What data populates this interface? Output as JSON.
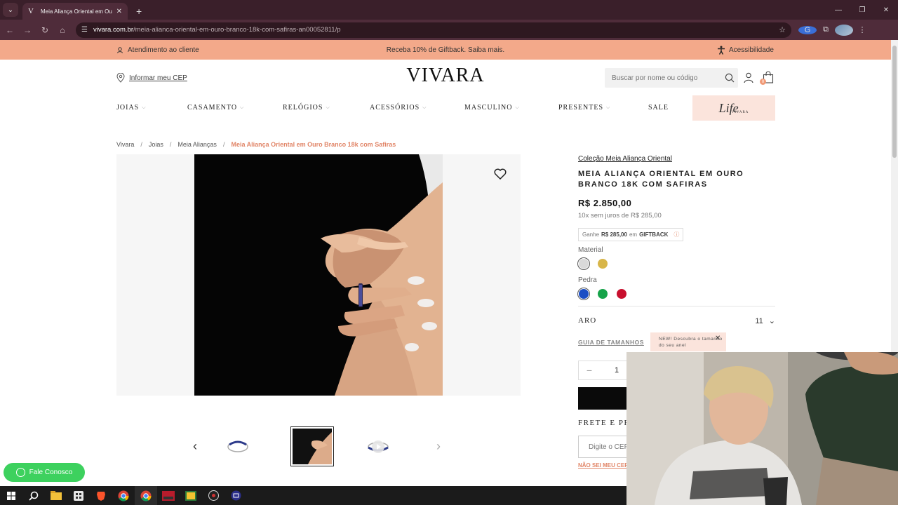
{
  "browser": {
    "tab_title": "Meia Aliança Oriental em Ouro Br",
    "tab_favicon": "V",
    "url_host": "vivara.com.br",
    "url_path": "/meia-alianca-oriental-em-ouro-branco-18k-com-safiras-an00052811/p",
    "extension_badge": "G"
  },
  "promo": {
    "support": "Atendimento ao cliente",
    "giftback": "Receba 10% de Giftback. Saiba mais.",
    "accessibility": "Acessibilidade"
  },
  "header": {
    "cep_link": "Informar meu CEP",
    "logo": "VIVARA",
    "search_placeholder": "Buscar por nome ou código",
    "bag_count": "0"
  },
  "nav": {
    "items": [
      "JOIAS",
      "CASAMENTO",
      "RELÓGIOS",
      "ACESSÓRIOS",
      "MASCULINO",
      "PRESENTES",
      "SALE"
    ],
    "life_logo": "Life",
    "life_sub": "VIVARA"
  },
  "breadcrumb": {
    "items": [
      "Vivara",
      "Joias",
      "Meia Alianças"
    ],
    "current": "Meia Aliança Oriental em Ouro Branco 18k com Safiras"
  },
  "product": {
    "collection": "Coleção Meia Aliança Oriental",
    "name": "MEIA ALIANÇA ORIENTAL EM OURO BRANCO 18K COM SAFIRAS",
    "price": "R$ 2.850,00",
    "installments": "10x sem juros de R$ 285,00",
    "giftback_prefix": "Ganhe",
    "giftback_amount": "R$ 285,00",
    "giftback_mid": "em",
    "giftback_label": "GIFTBACK",
    "material_label": "Material",
    "stone_label": "Pedra",
    "aro_label": "ARO",
    "aro_value": "11",
    "size_guide": "GUIA DE TAMANHOS",
    "tooltip": "NEW! Descubra o tamanho do seu anel",
    "quantity": "1",
    "shipping_title": "FRETE E PRA",
    "cep_placeholder": "Digite o CEP",
    "no_cep": "NÃO SEI MEU CEP",
    "colors": {
      "white_gold": "#d9d9d9",
      "yellow_gold": "#d8b64a",
      "sapphire": "#1c4fc4",
      "emerald": "#16a34a",
      "ruby": "#c8102e"
    }
  },
  "whatsapp": {
    "label": "Fale Conosco"
  },
  "colors": {
    "accent": "#f3a98a",
    "link_accent": "#e18567",
    "browser_frame": "#4f2c3a"
  }
}
